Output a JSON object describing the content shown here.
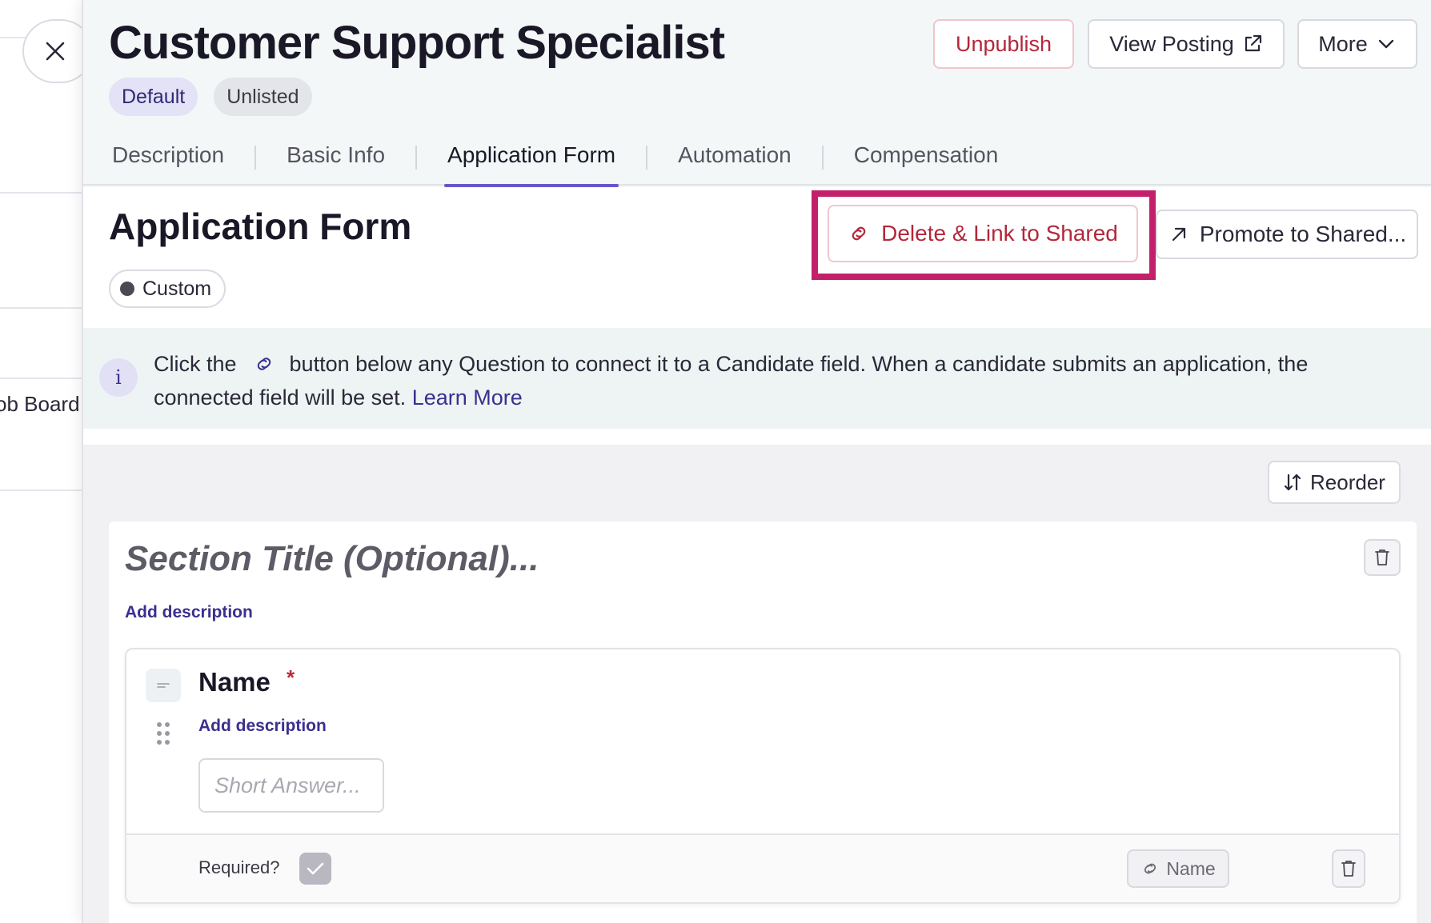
{
  "background": {
    "partial_text": "ob Board '"
  },
  "header": {
    "title": "Customer Support Specialist",
    "badges": [
      "Default",
      "Unlisted"
    ],
    "buttons": {
      "unpublish": "Unpublish",
      "view_posting": "View Posting",
      "more": "More"
    },
    "tabs": [
      {
        "label": "Description",
        "active": false
      },
      {
        "label": "Basic Info",
        "active": false
      },
      {
        "label": "Application Form",
        "active": true
      },
      {
        "label": "Automation",
        "active": false
      },
      {
        "label": "Compensation",
        "active": false
      }
    ]
  },
  "application_form": {
    "title": "Application Form",
    "status_pill": "Custom",
    "delete_link_button": "Delete & Link to Shared",
    "promote_button": "Promote to Shared...",
    "info": {
      "text_before": "Click the",
      "text_after": "button below any Question to connect it to a Candidate field. When a candidate submits an application, the connected field will be set.",
      "learn_more": "Learn More"
    },
    "reorder_button": "Reorder",
    "section": {
      "title_placeholder": "Section Title (Optional)...",
      "add_description": "Add description",
      "question": {
        "name": "Name",
        "required_marker": "*",
        "add_description": "Add description",
        "answer_placeholder": "Short Answer...",
        "required_label": "Required?",
        "required": true,
        "linked_field": "Name"
      }
    }
  },
  "colors": {
    "accent": "#6b55c8",
    "danger": "#b3273b",
    "highlight": "#c2206b",
    "link": "#3b2f8f"
  }
}
